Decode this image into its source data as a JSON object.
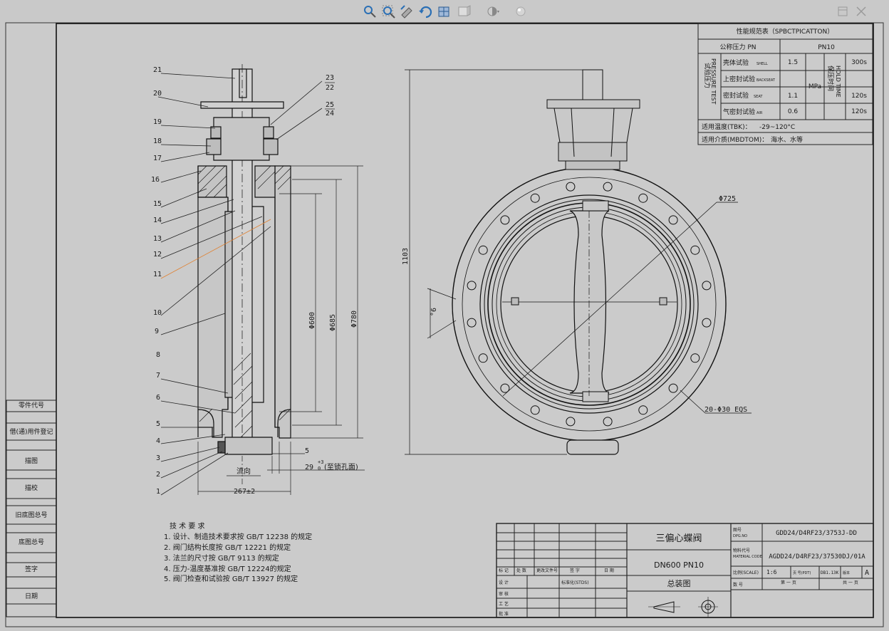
{
  "toolbar": {
    "buttons": [
      {
        "name": "zoom-to-fit-icon"
      },
      {
        "name": "zoom-to-area-icon"
      },
      {
        "name": "previous-view-icon"
      },
      {
        "name": "rotate-view-icon"
      },
      {
        "name": "section-view-icon"
      },
      {
        "name": "view-orientation-icon"
      },
      {
        "name": "display-style-icon"
      },
      {
        "name": "appearance-icon"
      }
    ],
    "window_buttons": [
      {
        "name": "restore-window-icon"
      },
      {
        "name": "close-window-icon"
      }
    ]
  },
  "left_column": [
    "零件代号",
    "借(通)用件登记",
    "描图",
    "描校",
    "旧底图总号",
    "底图总号",
    "签字",
    "日期"
  ],
  "spec_table": {
    "title": "性能规范表（SPBCTPICATTON）",
    "nominal_pressure_label": "公称压力 PN",
    "nominal_pressure_value": "PN10",
    "pressure_test_cn": "试验压力",
    "pressure_test_en": "PRESSURE TEST",
    "rows": [
      {
        "label": "壳体试验",
        "sub": "SHELL",
        "value": "1.5",
        "time": "300s"
      },
      {
        "label": "上密封试验",
        "sub": "BACKSEAT",
        "value": "",
        "time": ""
      },
      {
        "label": "密封试验",
        "sub": "SEAT",
        "value": "1.1",
        "time": "120s"
      },
      {
        "label": "气密封试验",
        "sub": "AIR",
        "value": "0.6",
        "time": "120s"
      }
    ],
    "unit": "MPa",
    "hold_time_cn": "保压时间",
    "hold_time_en": "HOLD TIME",
    "temp_label": "适用温度(TBK)：",
    "temp_value": "-29~120°C",
    "medium_label": "适用介质(MBDTOM)：",
    "medium_value": "海水、水等"
  },
  "callouts": [
    "21",
    "20",
    "19",
    "18",
    "17",
    "16",
    "15",
    "14",
    "13",
    "12",
    "11",
    "10",
    "9",
    "8",
    "7",
    "6",
    "5",
    "4",
    "3",
    "2",
    "1"
  ],
  "callouts_right": [
    "23",
    "22",
    "25",
    "24"
  ],
  "dimensions": {
    "d600": "Φ600",
    "d685": "Φ685",
    "d780": "Φ780",
    "height": "1103",
    "flow": "流向",
    "length": "267±2",
    "offset5": "5",
    "offset29": "29",
    "offset29_tol": "+3",
    "offset29_tol2": "0",
    "offset29_note": "(至锁孔面)",
    "d725": "Φ725",
    "bolts": "20-Φ30 EQS",
    "angle": "°6"
  },
  "technical_requirements": {
    "title": "技 术 要 求",
    "items": [
      "1. 设计、制造技术要求按 GB/T 12238 的规定",
      "2. 阀门结构长度按 GB/T 12221 的规定",
      "3. 法兰的尺寸按  GB/T 9113 的规定",
      "4. 压力-温度基准按 GB/T 12224的规定",
      "5. 阀门检查和试验按 GB/T 13927 的规定"
    ]
  },
  "title_block": {
    "name": "三偏心蝶阀",
    "spec": "DN600 PN10",
    "drawing_type": "总装图",
    "drawing_no_label": "图号",
    "drawing_no_sub": "DPG.NO",
    "drawing_no": "GDD24/D4RF23/3753J-DD",
    "material_label": "物料代号",
    "material_sub": "MATERIAL CODE",
    "material_code": "AGDD24/D4RF23/37530DJ/01A",
    "scale_label": "比例(SCALE)",
    "scale_value": "1:6",
    "sheet_label": "页 号(PDT)",
    "sheet_value": "DB1.13K",
    "version_label": "版本",
    "version_value": "A",
    "page_label": "数 号",
    "page_value": "第 一 页",
    "page_total": "共 一 页",
    "sign_cols": [
      "标 记",
      "处 数",
      "更改文件号",
      "签 字",
      "日 期"
    ],
    "sign_rows": [
      "设 计",
      "审 核",
      "工 艺",
      "批 准"
    ],
    "std_label": "标准化(STDS)"
  }
}
